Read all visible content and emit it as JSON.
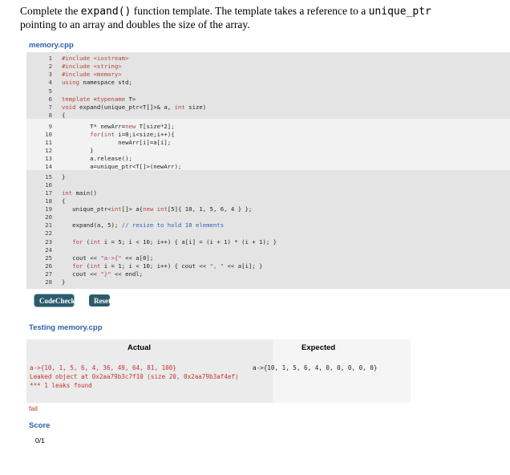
{
  "instructions": {
    "part1": "Complete the ",
    "code1": "expand()",
    "part2": " function template. The template takes a reference to a ",
    "code2": "unique_ptr",
    "part3": "pointing to an array and doubles the size of the array."
  },
  "editor": {
    "file_name": "memory.cpp",
    "lines": [
      {
        "n": "1",
        "html": "<span class=\"pp\">#include &lt;iostream&gt;</span>"
      },
      {
        "n": "2",
        "html": "<span class=\"pp\">#include &lt;string&gt;</span>"
      },
      {
        "n": "3",
        "html": "<span class=\"pp\">#include &lt;memory&gt;</span>"
      },
      {
        "n": "4",
        "html": "<span class=\"kw\">using</span> namespace std;"
      },
      {
        "n": "5",
        "html": ""
      },
      {
        "n": "6",
        "html": "<span class=\"kw\">template</span> &lt;<span class=\"kw\">typename</span> T&gt;"
      },
      {
        "n": "7",
        "html": "<span class=\"kw\">void</span> expand(unique_ptr&lt;T[]&gt;&amp; a, <span class=\"kw\">int</span> size)"
      },
      {
        "n": "8",
        "html": "{"
      },
      {
        "n": "9",
        "html": "        T* newArr=<span class=\"kw\">new</span> T[size*2];"
      },
      {
        "n": "10",
        "html": "        <span class=\"kw\">for</span>(<span class=\"kw\">int</span> i=0;i&lt;size;i++){"
      },
      {
        "n": "11",
        "html": "                newArr[i]=a[i];"
      },
      {
        "n": "12",
        "html": "        }"
      },
      {
        "n": "13",
        "html": "        a.release();"
      },
      {
        "n": "14",
        "html": "        a=unique_ptr&lt;T[]&gt;(newArr);"
      },
      {
        "n": "15",
        "html": "}"
      },
      {
        "n": "16",
        "html": ""
      },
      {
        "n": "17",
        "html": "<span class=\"kw\">int</span> main()"
      },
      {
        "n": "18",
        "html": "{"
      },
      {
        "n": "19",
        "html": "   unique_ptr&lt;<span class=\"kw\">int</span>[]&gt; a{<span class=\"kw\">new</span> <span class=\"kw\">int</span>[5]{ 10, 1, 5, 6, 4 } };"
      },
      {
        "n": "20",
        "html": ""
      },
      {
        "n": "21",
        "html": "   expand(a, 5); <span class=\"cm\">// resize to hold 10 elements</span>"
      },
      {
        "n": "22",
        "html": ""
      },
      {
        "n": "23",
        "html": "   <span class=\"kw\">for</span> (<span class=\"kw\">int</span> i = 5; i &lt; 10; i++) { a[i] = (i + 1) * (i + 1); }"
      },
      {
        "n": "24",
        "html": ""
      },
      {
        "n": "25",
        "html": "   cout &lt;&lt; <span class=\"str\">\"a-&gt;{\"</span> &lt;&lt; a[0];"
      },
      {
        "n": "26",
        "html": "   <span class=\"kw\">for</span> (<span class=\"kw\">int</span> i = 1; i &lt; 10; i++) { cout &lt;&lt; <span class=\"str\">\", \"</span> &lt;&lt; a[i]; }"
      },
      {
        "n": "27",
        "html": "   cout &lt;&lt; <span class=\"str\">\"}\"</span> &lt;&lt; endl;"
      },
      {
        "n": "28",
        "html": "}"
      }
    ]
  },
  "buttons": {
    "codecheck": "CodeCheck",
    "reset": "Reset"
  },
  "results": {
    "heading": "Testing memory.cpp",
    "actual_header": "Actual",
    "expected_header": "Expected",
    "actual_lines": [
      "a->{10, 1, 5, 6, 4, 36, 49, 64, 81, 100}",
      "Leaked object at 0x2aa79b3c7f10 (size 20, 0x2aa79b3af4ef)",
      "*** 1 leaks found"
    ],
    "expected_line": "a->{10, 1, 5, 6, 4, 0, 0, 0, 0, 0}",
    "status": "fail"
  },
  "score": {
    "label": "Score",
    "value": "0/1"
  }
}
